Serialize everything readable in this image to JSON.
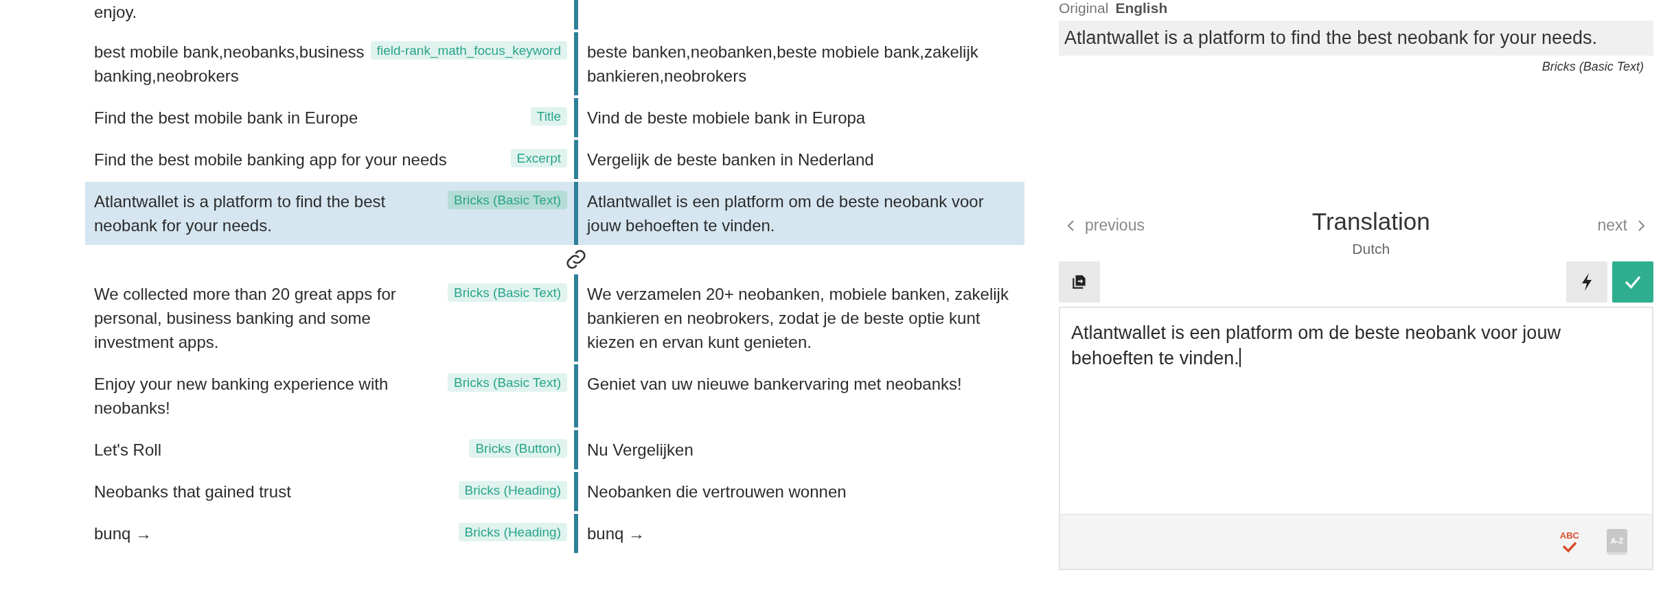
{
  "rows": [
    {
      "source": "enjoy.",
      "selected": false
    },
    {
      "source": "best mobile bank,neobanks,business banking,neobrokers",
      "type": "field-rank_math_focus_keyword",
      "target": "beste banken,neobanken,beste mobiele bank,zakelijk bankieren,neobrokers",
      "selected": false
    },
    {
      "source": "Find the best mobile bank in Europe",
      "type": "Title",
      "target": "Vind de beste mobiele bank in Europa",
      "selected": false
    },
    {
      "source": "Find the best mobile banking app for your needs",
      "type": "Excerpt",
      "target": "Vergelijk de beste banken in Nederland",
      "selected": false
    },
    {
      "source": "Atlantwallet is a platform to find the best neobank for your needs.",
      "type": "Bricks (Basic Text)",
      "target": "Atlantwallet is een platform om de beste neobank voor jouw behoeften te vinden.",
      "selected": true
    },
    {
      "source": "We collected more than 20 great apps for personal, business banking and some investment apps.",
      "type": "Bricks (Basic Text)",
      "target": "We verzamelen 20+ neobanken, mobiele banken, zakelijk bankieren en neobrokers, zodat je de beste optie kunt kiezen en ervan kunt genieten.",
      "selected": false
    },
    {
      "source": "Enjoy your new banking experience with neobanks!",
      "type": "Bricks (Basic Text)",
      "target": "Geniet van uw nieuwe bankervaring met neobanks!",
      "selected": false
    },
    {
      "source": "Let's Roll",
      "type": "Bricks (Button)",
      "target": "Nu Vergelijken",
      "selected": false
    },
    {
      "source": "Neobanks that gained trust",
      "type": "Bricks (Heading)",
      "target": "Neobanken die vertrouwen wonnen",
      "selected": false
    },
    {
      "source": "bunq →",
      "type": "Bricks (Heading)",
      "target": "bunq →",
      "selected": false
    }
  ],
  "original": {
    "label": "Original",
    "language": "English",
    "text": "Atlantwallet is a platform to find the best neobank for your needs.",
    "type": "Bricks (Basic Text)"
  },
  "translation": {
    "title": "Translation",
    "language": "Dutch",
    "previous": "previous",
    "next": "next",
    "text": "Atlantwallet is een platform om de beste neobank voor jouw behoeften te vinden.",
    "spellcheck_label": "ABC",
    "glossary_label": "A-Z"
  }
}
